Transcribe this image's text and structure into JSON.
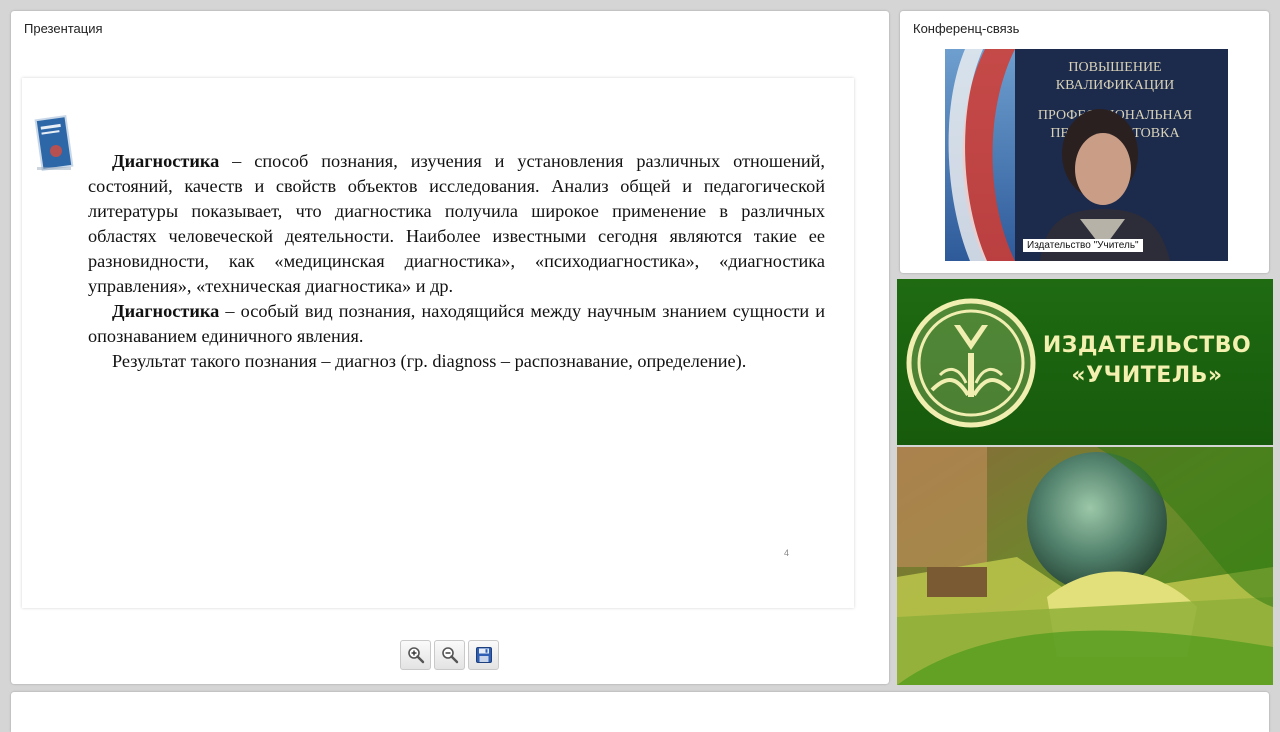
{
  "presentation": {
    "title": "Презентация",
    "slide": {
      "paragraph1_term": "Диагностика",
      "paragraph1_text": " – способ познания, изучения и установления различных отношений, состояний, качеств и свойств объектов исследования. Анализ общей и педагогической литературы показывает, что диагностика получила широкое применение в различных областях человеческой деятельности. Наиболее известными сегодня являются такие ее разновидности, как «медицинская диагностика», «психодиагностика», «диагностика управления», «техническая диагностика» и др.",
      "paragraph2_term": "Диагностика",
      "paragraph2_text": " – особый вид познания, находящийся между научным знанием сущности и опознаванием единичного явления.",
      "paragraph3_text": "Результат такого познания – диагноз (гр. diagnoss – распознавание, определение).",
      "page_number": "4"
    },
    "toolbar": {
      "zoom_in_icon": "zoom-in-icon",
      "zoom_out_icon": "zoom-out-icon",
      "save_icon": "save-icon"
    }
  },
  "conference": {
    "title": "Конференц-связь",
    "video_label": "Издательство \"Учитель\"",
    "banner_lines": [
      "ПОВЫШЕНИЕ",
      "КВАЛИФИКАЦИИ",
      "ПРОФЕССИОНАЛЬНАЯ",
      "ПЕРЕПОДГОТОВКА"
    ]
  },
  "brand": {
    "line1": "ИЗДАТЕЛЬСТВО",
    "line2": "«УЧИТЕЛЬ»"
  },
  "colors": {
    "brand_green": "#1f6b12",
    "brand_text": "#f3f0b0",
    "panel_bg": "#ffffff",
    "page_bg": "#d5d5d5"
  }
}
